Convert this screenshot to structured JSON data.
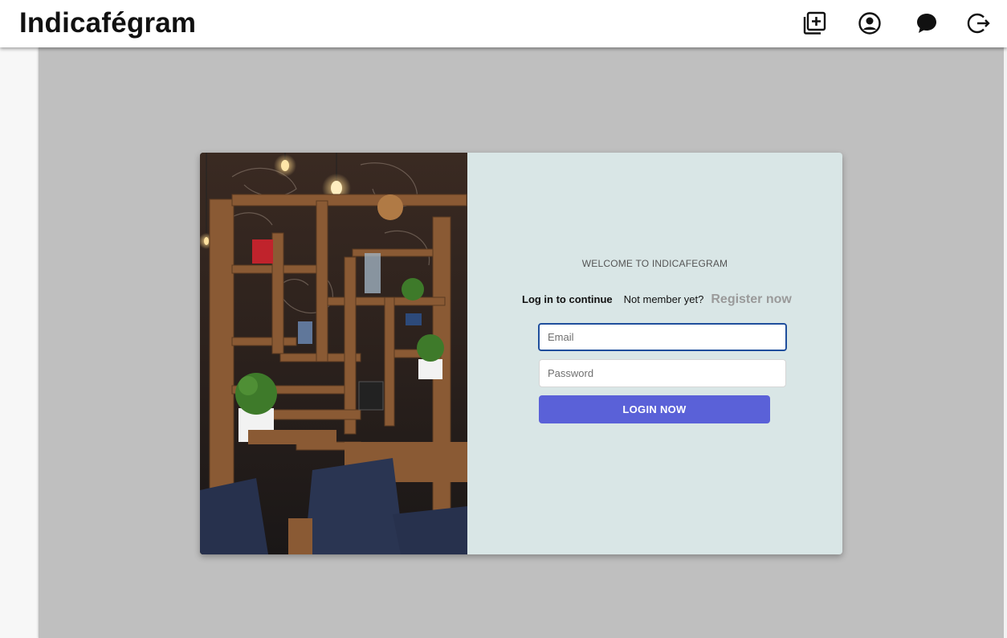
{
  "header": {
    "brand": "Indicafégram",
    "icons": [
      "add-post-icon",
      "profile-icon",
      "chat-icon",
      "logout-icon"
    ]
  },
  "login": {
    "welcome": "WELCOME TO INDICAFEGRAM",
    "prompt": "Log in to continue",
    "not_member": "Not member yet?",
    "register_link": "Register now",
    "email_placeholder": "Email",
    "password_placeholder": "Password",
    "submit_label": "LOGIN NOW"
  },
  "colors": {
    "accent": "#5a61d8",
    "panel": "#d9e6e6",
    "overlay": "#bfbfbf",
    "focus": "#1f4e9c"
  }
}
